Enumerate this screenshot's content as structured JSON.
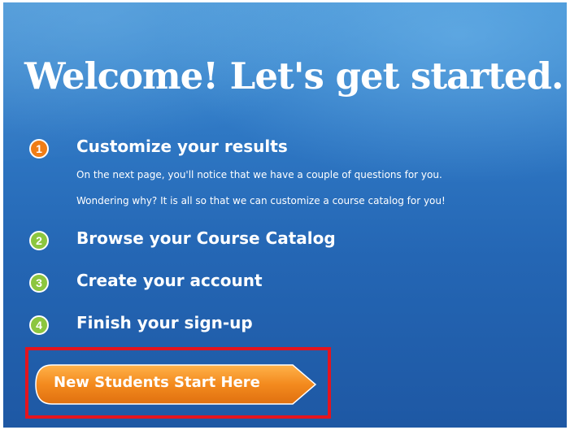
{
  "heading": "Welcome! Let's get started.",
  "steps": [
    {
      "number": "1",
      "title": "Customize your results",
      "description": [
        "On the next page, you'll notice that we have a couple of questions for you.",
        "Wondering why? It is all so that we can customize a course catalog for you!"
      ]
    },
    {
      "number": "2",
      "title": "Browse your Course Catalog"
    },
    {
      "number": "3",
      "title": "Create your account"
    },
    {
      "number": "4",
      "title": "Finish your sign-up"
    }
  ],
  "cta": {
    "label": "New Students Start Here"
  },
  "colors": {
    "background": "#2466b4",
    "active_step": "#f07d16",
    "pending_step": "#8cc63f",
    "cta": "#f08a1c",
    "highlight": "#e4141e"
  }
}
